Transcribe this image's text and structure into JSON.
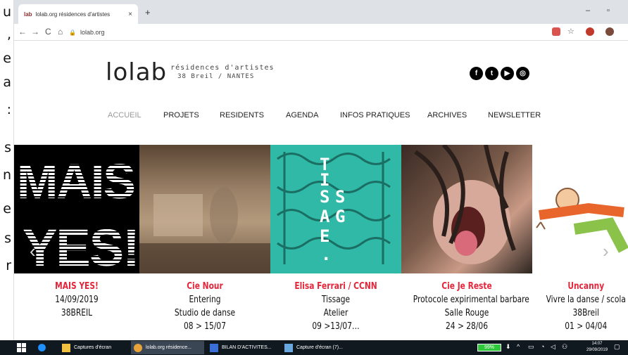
{
  "side_document": {
    "letters": [
      "u",
      ",",
      "e",
      "a",
      ":",
      "s",
      "n",
      "e",
      "s",
      "r"
    ]
  },
  "browser": {
    "tab": {
      "favicon": "lab",
      "title": "lolab.org résidences d'artistes",
      "close": "×"
    },
    "new_tab": "+",
    "window_controls": {
      "minimize": "–",
      "restore": "▫"
    },
    "nav": {
      "back": "←",
      "forward": "→",
      "reload": "C",
      "home": "⌂"
    },
    "url": "lolab.org"
  },
  "site": {
    "logo": {
      "word": "lolab",
      "tagline": "résidences d'artistes",
      "address": "38 Breil / NANTES"
    },
    "socials": [
      {
        "name": "facebook",
        "glyph": "f"
      },
      {
        "name": "twitter",
        "glyph": "t"
      },
      {
        "name": "youtube",
        "glyph": "▶"
      },
      {
        "name": "instagram",
        "glyph": "◎"
      }
    ],
    "menu": [
      "ACCUEIL",
      "PROJETS",
      "RESIDENTS",
      "AGENDA",
      "INFOS PRATIQUES",
      "ARCHIVES",
      "NEWSLETTER"
    ],
    "slides": [
      {
        "art_text": [
          "MAIS",
          "YES!"
        ]
      },
      {
        "art_text": []
      },
      {
        "art_text": [
          "T",
          "I",
          "S",
          "S",
          "A",
          "G",
          "E",
          "."
        ]
      },
      {
        "art_text": []
      },
      {
        "art_text": []
      }
    ],
    "events": [
      {
        "title": "MAIS YES!",
        "lines": [
          "14/09/2019",
          "38BREIL"
        ]
      },
      {
        "title": "Cie Nour",
        "lines": [
          "Entering",
          "Studio de danse",
          "08 > 15/07"
        ]
      },
      {
        "title": "Elisa Ferrari / CCNN",
        "lines": [
          "Tissage",
          "Atelier",
          "09 >13/07…"
        ]
      },
      {
        "title": "Cie Je Reste",
        "lines": [
          "Protocole expirimental barbare",
          "Salle Rouge",
          "24 > 28/06"
        ]
      },
      {
        "title": "Uncanny",
        "lines": [
          "Vivre la danse / scola",
          "38Breil",
          "01 > 04/04"
        ]
      }
    ]
  },
  "taskbar": {
    "tasks": [
      {
        "label": "Captures d'écran"
      },
      {
        "label": "lolab.org résidence..."
      },
      {
        "label": "BILAN D'ACTIVITES..."
      },
      {
        "label": "Capture d'écran (7)..."
      }
    ],
    "battery": "99%",
    "time": "14:07",
    "date": "29/09/2019"
  },
  "colors": {
    "accent_red": "#e5253a",
    "taskbar": "#101820",
    "tissage_teal": "#2fb9a6"
  }
}
